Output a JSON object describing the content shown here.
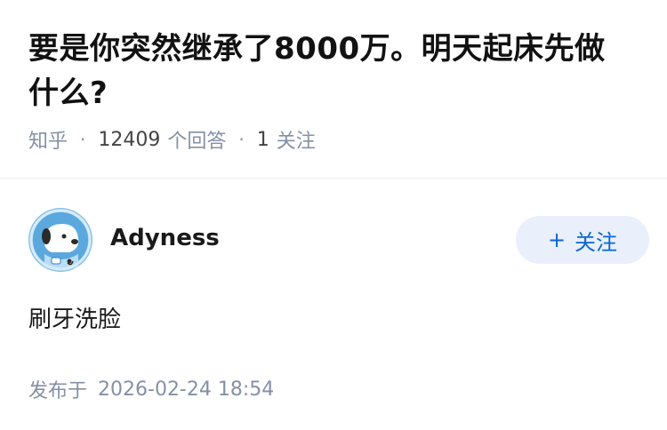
{
  "question": {
    "title": "要是你突然继承了8000万。明天起床先做什么?",
    "source": "知乎",
    "answer_count": "12409",
    "answer_label": "个回答",
    "follow_count": "1",
    "follow_label": "关注"
  },
  "answer": {
    "author_name": "Adyness",
    "follow_button_label": "关注",
    "follow_button_prefix": "+",
    "content": "刷牙洗脸",
    "publish_label": "发布于",
    "publish_time": "2026-02-24 18:54"
  },
  "colors": {
    "meta_gray": "#8590a6",
    "follow_blue": "#0a66d6",
    "follow_bg": "#e9f0fb",
    "avatar_bg": "#8cc3ea"
  }
}
